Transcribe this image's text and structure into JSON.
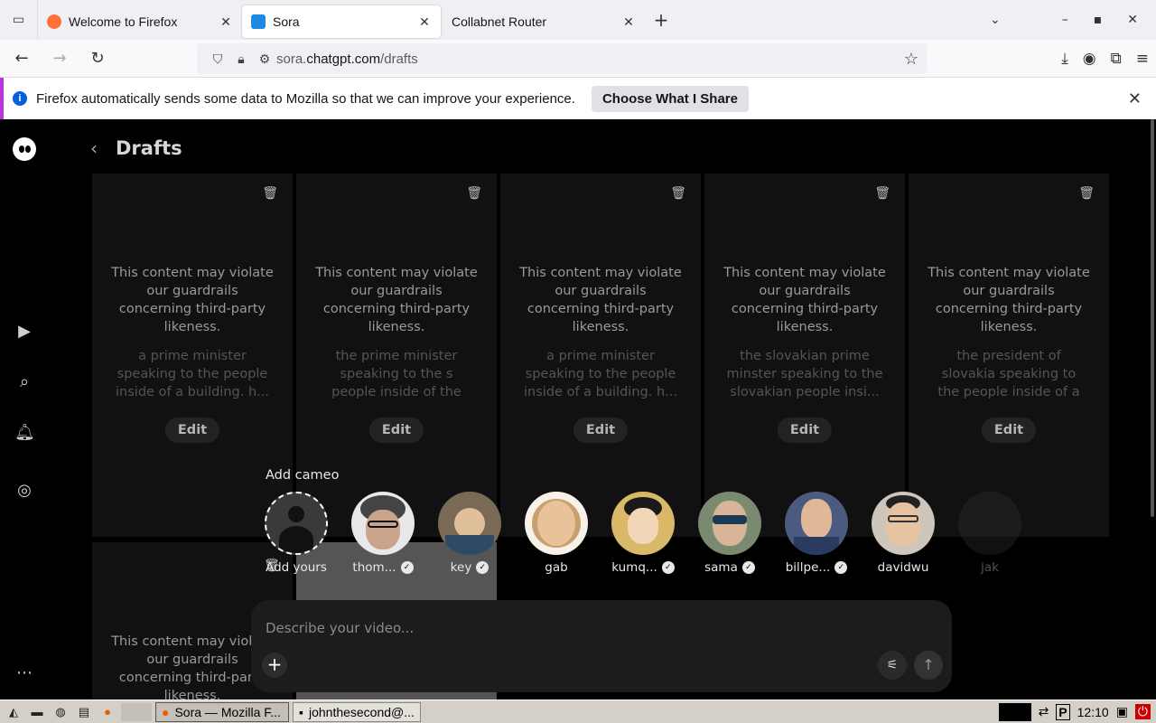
{
  "browser": {
    "tabs": [
      {
        "title": "Welcome to Firefox",
        "favicon": "firefox-icon",
        "color": "#ff7139",
        "active": false
      },
      {
        "title": "Sora",
        "favicon": "sora-icon",
        "color": "#1e88e5",
        "active": true
      },
      {
        "title": "Collabnet Router",
        "favicon": "",
        "color": "",
        "active": false
      }
    ],
    "url": {
      "prefix": "sora.",
      "host": "chatgpt.com",
      "path": "/drafts"
    },
    "notification": {
      "message": "Firefox automatically sends some data to Mozilla so that we can improve your experience.",
      "button": "Choose What I Share"
    }
  },
  "app": {
    "header": {
      "title": "Drafts"
    },
    "cards": [
      {
        "warning": "This content may violate our guardrails concerning third-party likeness.",
        "prompt": "a prime minister speaking to the people inside of a building. h...",
        "edit": "Edit"
      },
      {
        "warning": "This content may violate our guardrails concerning third-party likeness.",
        "prompt": "the prime minister speaking to the s people inside of the president...",
        "edit": "Edit"
      },
      {
        "warning": "This content may violate our guardrails concerning third-party likeness.",
        "prompt": "a prime minister speaking to the people inside of a building. h...",
        "edit": "Edit"
      },
      {
        "warning": "This content may violate our guardrails concerning third-party likeness.",
        "prompt": "the slovakian prime minster speaking to the slovakian people insi...",
        "edit": "Edit"
      },
      {
        "warning": "This content may violate our guardrails concerning third-party likeness.",
        "prompt": "the president of slovakia speaking to the people inside of a building. h...",
        "edit": "Edit"
      }
    ],
    "second_row_card": {
      "warning": "This content may violate our guardrails concerning third-party likeness."
    },
    "cameo": {
      "label": "Add cameo",
      "items": [
        {
          "name": "Add yours",
          "verified": false,
          "bg": "#3a3a3a"
        },
        {
          "name": "thom...",
          "verified": true,
          "bg": "#e8e8e8"
        },
        {
          "name": "key",
          "verified": true,
          "bg": "#7a6a55"
        },
        {
          "name": "gab",
          "verified": false,
          "bg": "#c8a070"
        },
        {
          "name": "kumq...",
          "verified": true,
          "bg": "#d9b86a"
        },
        {
          "name": "sama",
          "verified": true,
          "bg": "#7a8a70"
        },
        {
          "name": "billpe...",
          "verified": true,
          "bg": "#4a5a80"
        },
        {
          "name": "davidwu",
          "verified": false,
          "bg": "#cfc6bb"
        },
        {
          "name": "jak",
          "verified": false,
          "bg": "#333333"
        }
      ]
    },
    "composer": {
      "placeholder": "Describe your video..."
    }
  },
  "taskbar": {
    "tasks": [
      {
        "label": "Sora — Mozilla F...",
        "active": true
      },
      {
        "label": "johnthesecond@...",
        "active": false
      }
    ],
    "clock": "12:10"
  }
}
